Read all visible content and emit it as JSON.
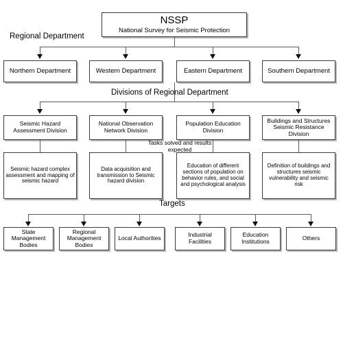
{
  "diagram": {
    "title": "NSSP organizational structure",
    "root": {
      "title": "NSSP",
      "subtitle": "National Survey for Seismic Protection"
    },
    "section_labels": {
      "regional_department": "Regional Department",
      "divisions": "Divisions of Regional Department",
      "tasks": "Tasks solved and results expected",
      "targets": "Targets"
    },
    "departments": [
      {
        "label": "Northern Department"
      },
      {
        "label": "Western Department"
      },
      {
        "label": "Eastern Department"
      },
      {
        "label": "Southern Department"
      }
    ],
    "divisions": [
      {
        "label": "Seismic Hazard Assessment Division"
      },
      {
        "label": "National Observation Network Division"
      },
      {
        "label": "Population Education Division"
      },
      {
        "label": "Buildings and Structures Seismic Resistance Division"
      }
    ],
    "tasks": [
      {
        "label": "Seismic hazard complex assessment and mapping of seismic hazard"
      },
      {
        "label": "Data acquisition and transmission to Seismic hazard division"
      },
      {
        "label": "Education of different sections of population on behavior rules, and social and psychological analysis"
      },
      {
        "label": "Definition of buildings and structures seismic vulnerability and seismic risk"
      }
    ],
    "targets": [
      {
        "label": "State Management Bodies"
      },
      {
        "label": "Regional Management Bodies"
      },
      {
        "label": "Local Authorities"
      },
      {
        "label": "Industrial Facilities"
      },
      {
        "label": "Education Institutions"
      },
      {
        "label": "Others"
      }
    ],
    "colors": {
      "box_border": "#3a3a3a",
      "box_shadow": "#b5b5b5",
      "connector": "#5a5a5a",
      "arrow": "#111111",
      "text": "#000000",
      "background": "#ffffff"
    }
  }
}
